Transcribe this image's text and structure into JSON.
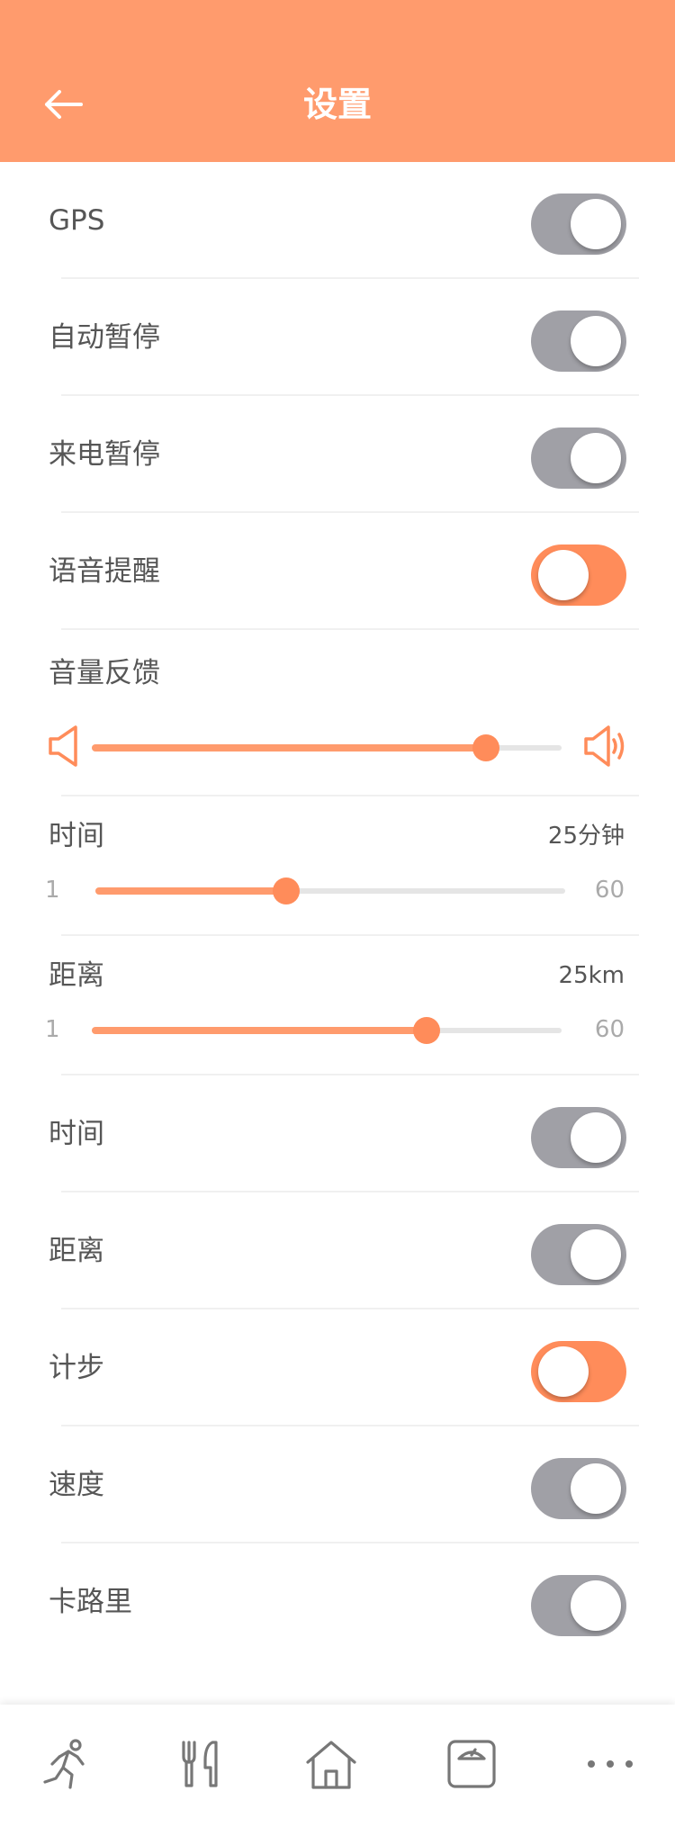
{
  "header": {
    "title": "设置",
    "back_icon": "arrow-left-icon",
    "color": "#FF9B6D"
  },
  "settings": {
    "gps": {
      "label": "GPS",
      "on": false
    },
    "auto_pause": {
      "label": "自动暂停",
      "on": false
    },
    "call_pause": {
      "label": "来电暂停",
      "on": false
    },
    "voice_alert": {
      "label": "语音提醒",
      "on": true
    },
    "time_toggle": {
      "label": "时间",
      "on": false
    },
    "distance_toggle": {
      "label": "距离",
      "on": false
    },
    "steps_toggle": {
      "label": "计步",
      "on": true
    },
    "speed_toggle": {
      "label": "速度",
      "on": false
    },
    "calorie_toggle": {
      "label": "卡路里",
      "on": false
    }
  },
  "volume": {
    "label": "音量反馈",
    "level": 0.84
  },
  "time_range": {
    "label": "时间",
    "value_text": "25分钟",
    "min": "1",
    "max": "60",
    "value": 25
  },
  "distance_range": {
    "label": "距离",
    "value_text": "25km",
    "min": "1",
    "max": "60",
    "value": 43
  },
  "tabbar": [
    "run-icon",
    "cutlery-icon",
    "home-icon",
    "scale-icon",
    "more-icon"
  ],
  "colors": {
    "accent": "#FF9B6D",
    "toggle_off": "#a0a0a6",
    "toggle_on": "#FF8C5A"
  }
}
